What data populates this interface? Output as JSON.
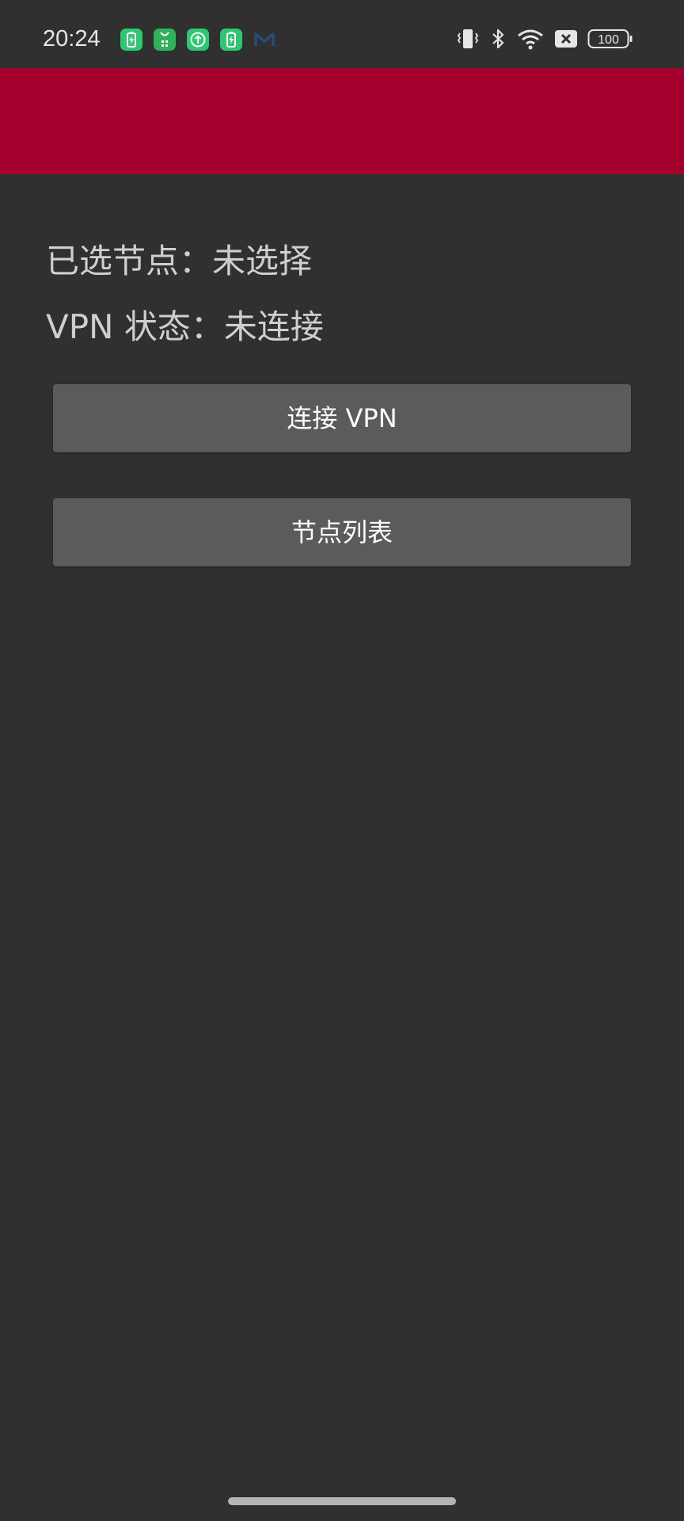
{
  "status_bar": {
    "time": "20:24",
    "notification_icons": [
      "battery-charge-icon",
      "app-store-icon",
      "upload-icon",
      "battery-charge-icon",
      "gmail-icon"
    ],
    "system_icons": [
      "vibrate-icon",
      "bluetooth-icon",
      "wifi-icon",
      "no-sim-icon",
      "battery-icon"
    ],
    "battery_level": "100"
  },
  "app_bar": {
    "color": "#a3002d"
  },
  "main": {
    "selected_node_label": "已选节点：",
    "selected_node_value": "未选择",
    "vpn_status_label": "VPN 状态：",
    "vpn_status_value": "未连接",
    "connect_button_label": "连接 VPN",
    "node_list_button_label": "节点列表"
  },
  "colors": {
    "background": "#303030",
    "button": "#5b5b5c",
    "accent": "#a3002d",
    "notification_green": "#2fc872"
  }
}
